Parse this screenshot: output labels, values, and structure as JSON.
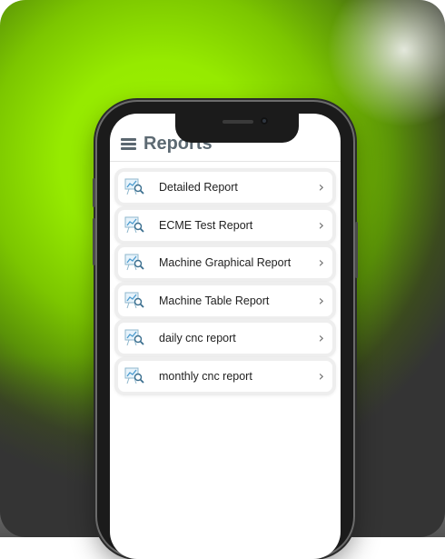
{
  "header": {
    "title": "Reports",
    "menu_icon": "hamburger-menu-icon"
  },
  "reports": [
    {
      "label": "Detailed Report",
      "icon": "report-chart-icon"
    },
    {
      "label": "ECME Test Report",
      "icon": "report-chart-icon"
    },
    {
      "label": "Machine Graphical Report",
      "icon": "report-chart-icon"
    },
    {
      "label": "Machine Table Report",
      "icon": "report-chart-icon"
    },
    {
      "label": "daily cnc report",
      "icon": "report-chart-icon"
    },
    {
      "label": "monthly cnc report",
      "icon": "report-chart-icon"
    }
  ],
  "chevron_glyph": "›",
  "colors": {
    "background_accent": "#96ea00",
    "title": "#5d6a73"
  }
}
